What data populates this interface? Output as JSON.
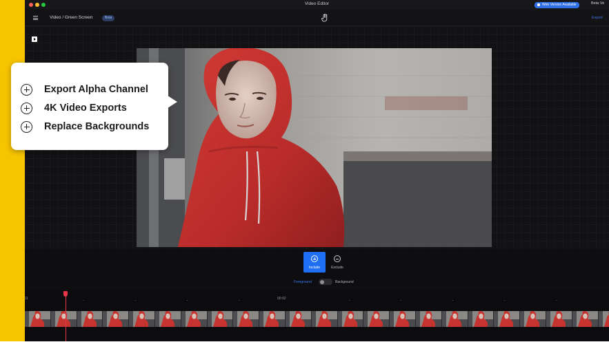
{
  "window": {
    "title": "Video Editor",
    "web_badge": "Web Version Available",
    "beta_version": "Beta Ve"
  },
  "toolbar": {
    "breadcrumb": "Video / Green Screen",
    "beta_badge": "Beta",
    "export_label": "Export"
  },
  "callout": {
    "features": [
      "Export Alpha Channel",
      "4K Video Exports",
      "Replace Backgrounds"
    ]
  },
  "controls": {
    "include_label": "Include",
    "exclude_label": "Exclude",
    "foreground_label": "Foreground",
    "background_label": "Background",
    "toggle_state": "foreground"
  },
  "timeline": {
    "start_label": "01",
    "mid_label": "00:02"
  },
  "colors": {
    "accent": "#1f6ff5",
    "playhead": "#e8354a",
    "side_strip": "#f7c400",
    "hoodie": "#c7332f"
  },
  "icons": [
    "menu-icon",
    "hand-cursor-icon",
    "play-icon",
    "lock-icon",
    "plus-circle-icon",
    "minus-circle-icon"
  ]
}
